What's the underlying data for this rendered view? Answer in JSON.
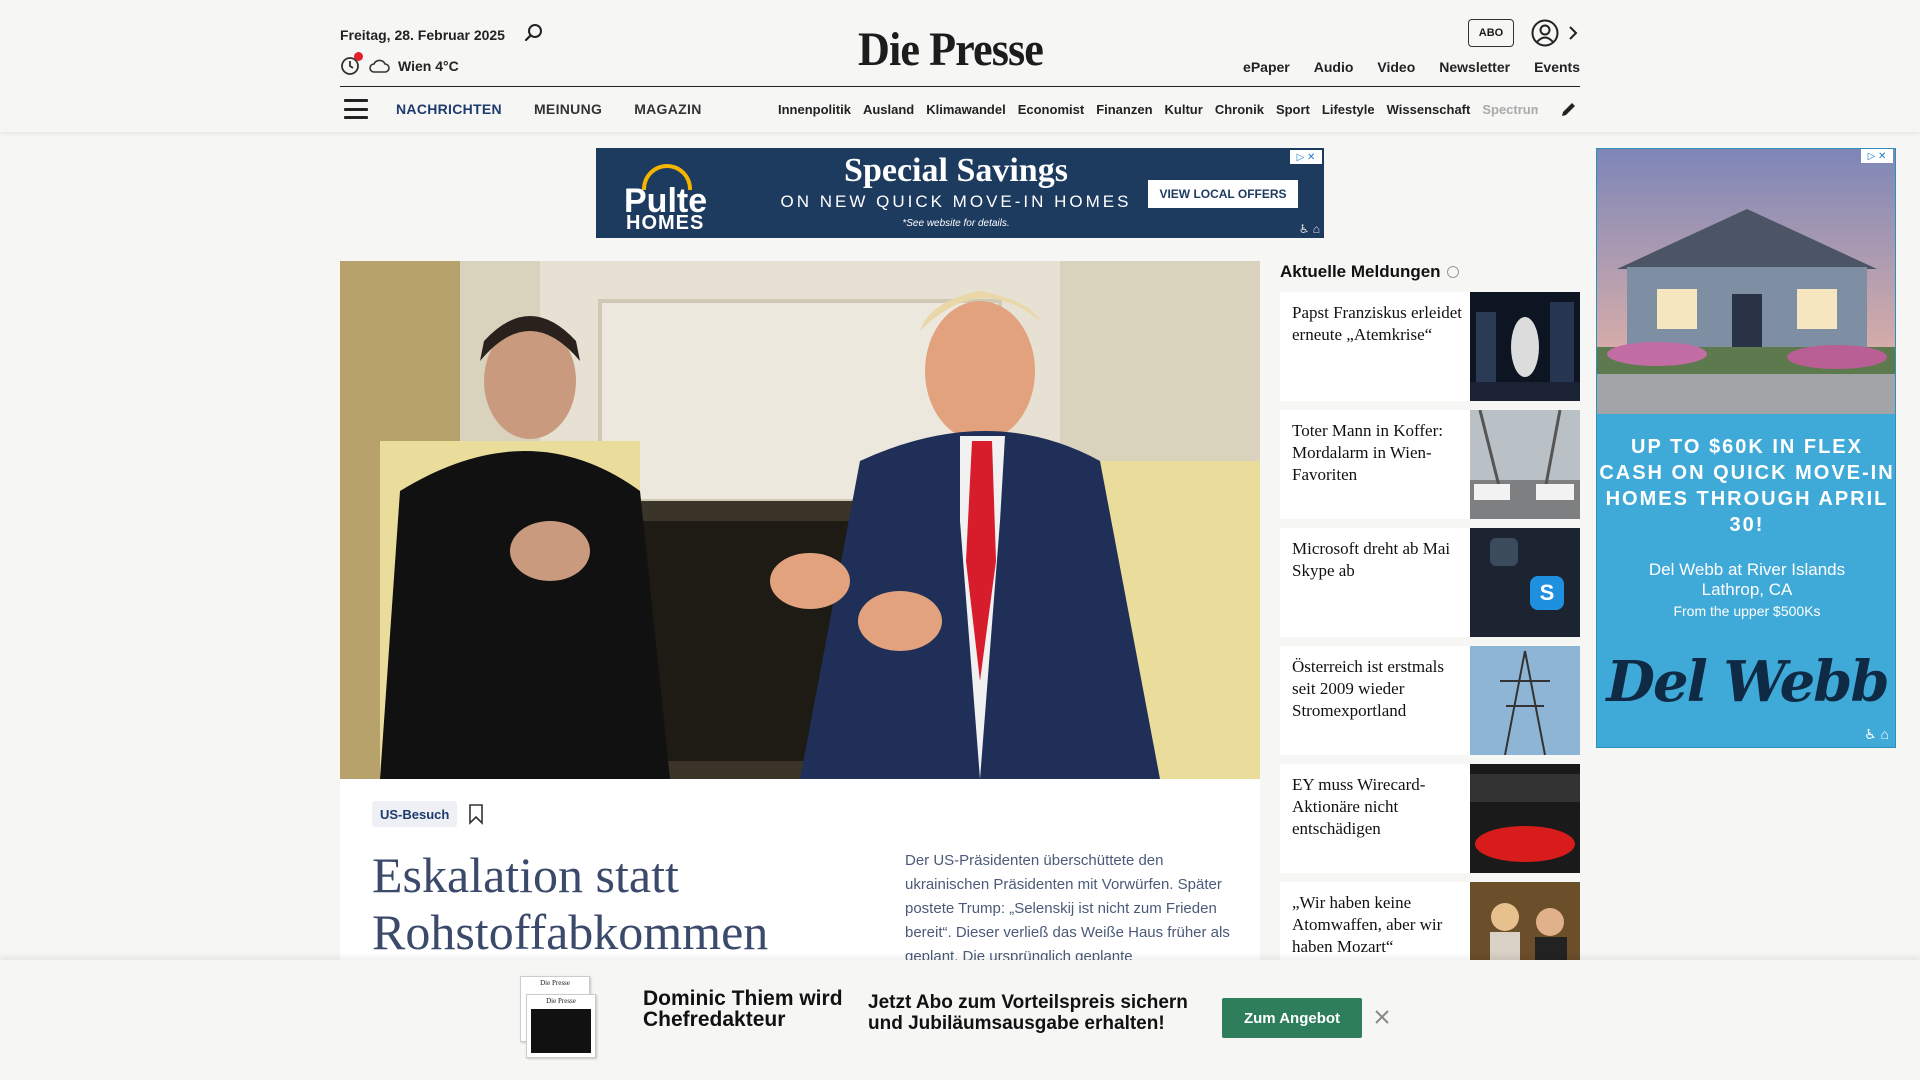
{
  "header": {
    "date": "Freitag, 28. Februar 2025",
    "weather": "Wien 4°C",
    "logo": "Die Presse",
    "abo_label": "ABO",
    "top_links": [
      "ePaper",
      "Audio",
      "Video",
      "Newsletter",
      "Events"
    ],
    "main_nav": [
      {
        "label": "NACHRICHTEN",
        "active": true
      },
      {
        "label": "MEINUNG",
        "active": false
      },
      {
        "label": "MAGAZIN",
        "active": false
      }
    ],
    "sub_nav": [
      "Innenpolitik",
      "Ausland",
      "Klimawandel",
      "Economist",
      "Finanzen",
      "Kultur",
      "Chronik",
      "Sport",
      "Lifestyle",
      "Wissenschaft",
      "Spectrum"
    ]
  },
  "top_ad": {
    "brand_line1": "Pulte",
    "brand_line2": "HOMES",
    "headline": "Special Savings",
    "sub": "ON NEW QUICK MOVE-IN HOMES",
    "note": "*See website for details.",
    "cta": "VIEW LOCAL OFFERS",
    "bg_color": "#1d3a5f"
  },
  "hero": {
    "tag": "US-Besuch",
    "headline": "Eskalation statt Rohstoffabkommen",
    "teaser": "Der US-Präsidenten überschüttete den ukrainischen Präsidenten mit Vorwürfen. Später postete Trump: „Selenskij ist nicht zum Frieden bereit“. Dieser verließ das Weiße Haus früher als geplant. Die ursprünglich geplante"
  },
  "news": {
    "title": "Aktuelle Meldungen",
    "items": [
      {
        "title": "Papst Franziskus erleidet erneute „Atemkrise“"
      },
      {
        "title": "Toter Mann in Koffer: Mordalarm in Wien-Favoriten"
      },
      {
        "title": "Microsoft dreht ab Mai Skype ab"
      },
      {
        "title": "Österreich ist erstmals seit 2009 wieder Stromexportland"
      },
      {
        "title": "EY muss Wirecard-Aktionäre nicht entschädigen"
      },
      {
        "title": "„Wir haben keine Atomwaffen, aber wir haben Mozart“"
      }
    ]
  },
  "side_ad": {
    "headline": "UP TO $60K IN FLEX CASH ON QUICK MOVE-IN HOMES THROUGH APRIL 30!",
    "location1": "Del Webb at River Islands",
    "location2": "Lathrop, CA",
    "price": "From the upper $500Ks",
    "logo": "Del Webb",
    "bg_color": "#3fa9d8"
  },
  "promo": {
    "name": "Dominic Thiem wird Chefredakteur",
    "offer": "Jetzt Abo zum Vorteilspreis sichern und Jubiläumsausgabe erhalten!",
    "cta": "Zum Angebot",
    "paper_label": "Die Presse"
  }
}
